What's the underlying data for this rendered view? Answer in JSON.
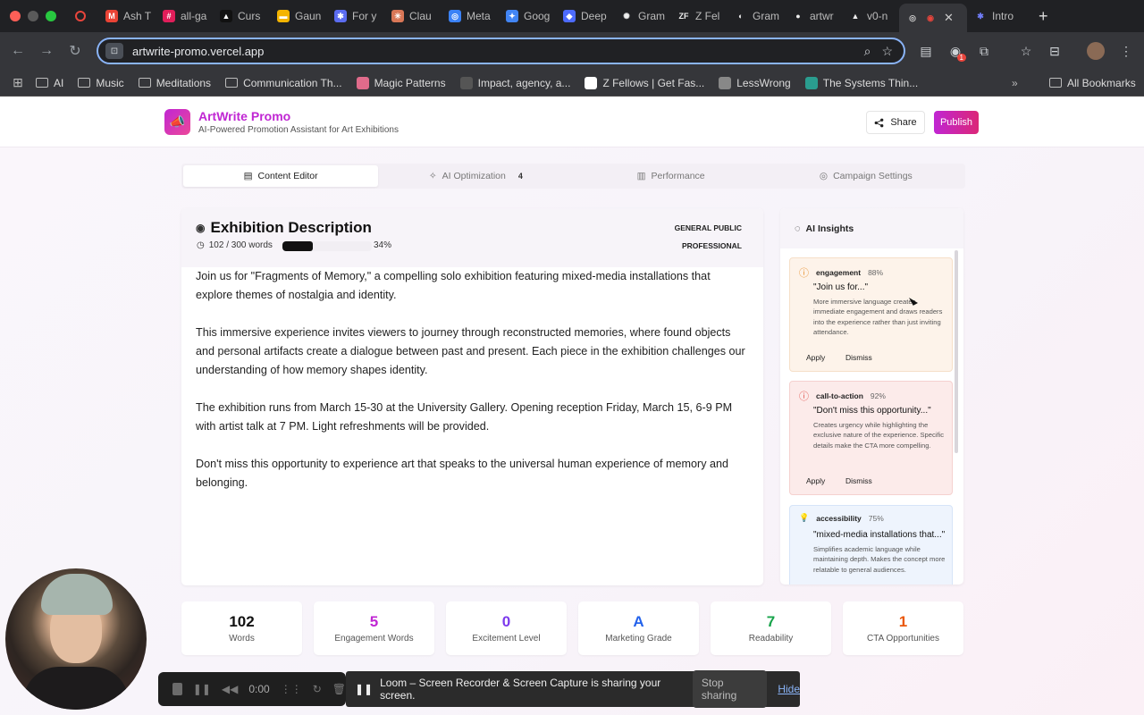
{
  "browser": {
    "tabs": [
      {
        "label": "",
        "color": "#e8453c",
        "icon": "record-icon"
      },
      {
        "label": "Ash T",
        "color": "#ea4335",
        "icon": "gmail-icon",
        "glyph": "M"
      },
      {
        "label": "all-ga",
        "color": "#e01e5a",
        "icon": "slack-icon",
        "glyph": "#"
      },
      {
        "label": "Curs",
        "color": "#111111",
        "icon": "cursor-icon",
        "glyph": "▲"
      },
      {
        "label": "Gaun",
        "color": "#f4b400",
        "icon": "slides-icon",
        "glyph": "▬"
      },
      {
        "label": "For y",
        "color": "#5b6cf0",
        "icon": "asterisk-icon",
        "glyph": "✱"
      },
      {
        "label": "Clau",
        "color": "#d97757",
        "icon": "claude-icon",
        "glyph": "✳"
      },
      {
        "label": "Meta",
        "color": "#3b82f6",
        "icon": "meta-icon",
        "glyph": "◎"
      },
      {
        "label": "Goog",
        "color": "#4285f4",
        "icon": "gemini-icon",
        "glyph": "✦"
      },
      {
        "label": "Deep",
        "color": "#4d6bfe",
        "icon": "deepseek-icon",
        "glyph": "◆"
      },
      {
        "label": "Gram",
        "color": "#dddddd",
        "icon": "openai-icon",
        "glyph": "✺"
      },
      {
        "label": "Z Fel",
        "color": "#ffffff",
        "icon": "zfellows-icon",
        "glyph": "ZF"
      },
      {
        "label": "Gram",
        "color": "#ffffff",
        "icon": "vercel-icon",
        "glyph": "◐"
      },
      {
        "label": "artwr",
        "color": "#ffffff",
        "icon": "github-icon",
        "glyph": "●"
      },
      {
        "label": "v0-n",
        "color": "#ffffff",
        "icon": "v0-icon",
        "glyph": "▲"
      }
    ],
    "active_tab": {
      "label": "",
      "icon": "globe-icon"
    },
    "after_tab": {
      "label": "Intro",
      "icon": "asterisk-icon"
    },
    "url": "artwrite-promo.vercel.app",
    "bookmarks": [
      {
        "label": "AI",
        "icon": "folder-icon"
      },
      {
        "label": "Music",
        "icon": "folder-icon"
      },
      {
        "label": "Meditations",
        "icon": "folder-icon"
      },
      {
        "label": "Communication Th...",
        "icon": "folder-icon"
      },
      {
        "label": "Magic Patterns",
        "icon": "magic-patterns-icon",
        "color": "#e06b8b"
      },
      {
        "label": "Impact, agency, a...",
        "icon": "bk-icon",
        "color": "#555555"
      },
      {
        "label": "Z Fellows | Get Fas...",
        "icon": "zfellows-icon",
        "color": "#ffffff"
      },
      {
        "label": "LessWrong",
        "icon": "lesswrong-icon",
        "color": "#888888"
      },
      {
        "label": "The Systems Thin...",
        "icon": "systems-icon",
        "color": "#2a9d8f"
      }
    ],
    "all_bookmarks": "All Bookmarks",
    "extension_badge": "1"
  },
  "app": {
    "brand": "ArtWrite Promo",
    "tagline": "AI-Powered Promotion Assistant for Art Exhibitions",
    "share_label": "Share",
    "publish_label": "Publish",
    "accent_color": "#c026d3"
  },
  "nav": {
    "tabs": [
      {
        "label": "Content Editor",
        "icon": "document-icon",
        "badge": ""
      },
      {
        "label": "AI Optimization",
        "icon": "sparkle-icon",
        "badge": "4"
      },
      {
        "label": "Performance",
        "icon": "bar-chart-icon",
        "badge": ""
      },
      {
        "label": "Campaign Settings",
        "icon": "target-icon",
        "badge": ""
      }
    ],
    "active": "Content Editor"
  },
  "editor": {
    "title": "Exhibition Description",
    "word_count": "102 / 300 words",
    "progress_fraction": 0.34,
    "progress_label": "34%",
    "audience_1": "GENERAL PUBLIC",
    "audience_2": "PROFESSIONAL",
    "paragraphs": [
      "Join us for \"Fragments of Memory,\" a compelling solo exhibition featuring mixed-media installations that explore themes of nostalgia and identity.",
      "This immersive experience invites viewers to journey through reconstructed memories, where found objects and personal artifacts create a dialogue between past and present. Each piece in the exhibition challenges our understanding of how memory shapes identity.",
      "The exhibition runs from March 15-30 at the University Gallery. Opening reception Friday, March 15, 6-9 PM with artist talk at 7 PM. Light refreshments will be provided.",
      "Don't miss this opportunity to experience art that speaks to the universal human experience of memory and belonging."
    ]
  },
  "insights": {
    "title": "AI Insights",
    "cards": [
      {
        "type": "engagement",
        "score": "88%",
        "quote": "\"Join us for...\"",
        "desc": "More immersive language creates immediate engagement and draws readers into the experience rather than just inviting attendance.",
        "apply": "Apply",
        "dismiss": "Dismiss",
        "bg": "#fdf3ea",
        "border": "#f6dfc8",
        "icon_color": "#e8912d",
        "icon": "alert-circle-icon"
      },
      {
        "type": "call-to-action",
        "score": "92%",
        "quote": "\"Don't miss this opportunity...\"",
        "desc": "Creates urgency while highlighting the exclusive nature of the experience. Specific details make the CTA more compelling.",
        "apply": "Apply",
        "dismiss": "Dismiss",
        "bg": "#fcebea",
        "border": "#f5d1cf",
        "icon_color": "#e0514a",
        "icon": "alert-circle-icon"
      },
      {
        "type": "accessibility",
        "score": "75%",
        "quote": "\"mixed-media installations that...\"",
        "desc": "Simplifies academic language while maintaining depth. Makes the concept more relatable to general audiences.",
        "apply": "",
        "dismiss": "",
        "bg": "#eef4fd",
        "border": "#d6e4f8",
        "icon_color": "#4a86e8",
        "icon": "lightbulb-icon"
      }
    ]
  },
  "stats": [
    {
      "value": "102",
      "label": "Words",
      "color": "#111111"
    },
    {
      "value": "5",
      "label": "Engagement Words",
      "color": "#c026d3"
    },
    {
      "value": "0",
      "label": "Excitement Level",
      "color": "#7c3aed"
    },
    {
      "value": "A",
      "label": "Marketing Grade",
      "color": "#2563eb"
    },
    {
      "value": "7",
      "label": "Readability",
      "color": "#16a34a"
    },
    {
      "value": "1",
      "label": "CTA Opportunities",
      "color": "#ea580c"
    }
  ],
  "recorder": {
    "time": "0:00",
    "message": "Loom – Screen Recorder & Screen Capture is sharing your screen.",
    "stop_label": "Stop sharing",
    "hide_label": "Hide"
  }
}
